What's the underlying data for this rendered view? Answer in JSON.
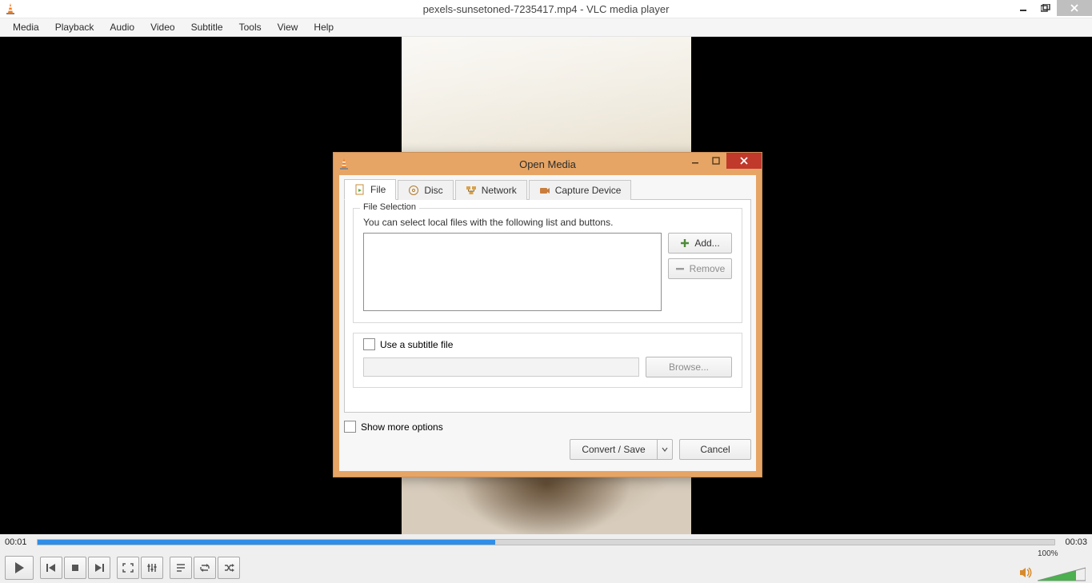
{
  "window": {
    "title": "pexels-sunsetoned-7235417.mp4 - VLC media player"
  },
  "menu": {
    "media": "Media",
    "playback": "Playback",
    "audio": "Audio",
    "video": "Video",
    "subtitle": "Subtitle",
    "tools": "Tools",
    "view": "View",
    "help": "Help"
  },
  "player": {
    "time_current": "00:01",
    "time_total": "00:03",
    "volume_percent": "100%"
  },
  "dialog": {
    "title": "Open Media",
    "tabs": {
      "file": "File",
      "disc": "Disc",
      "network": "Network",
      "capture": "Capture Device"
    },
    "file_selection_legend": "File Selection",
    "file_selection_hint": "You can select local files with the following list and buttons.",
    "add_button": "Add...",
    "remove_button": "Remove",
    "use_subtitle_label": "Use a subtitle file",
    "browse_button": "Browse...",
    "show_more_options": "Show more options",
    "convert_save": "Convert / Save",
    "cancel": "Cancel"
  }
}
